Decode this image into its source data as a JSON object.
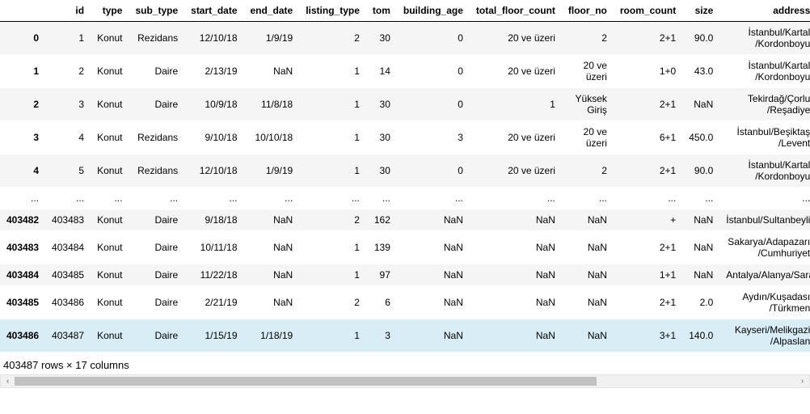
{
  "columns": [
    "",
    "id",
    "type",
    "sub_type",
    "start_date",
    "end_date",
    "listing_type",
    "tom",
    "building_age",
    "total_floor_count",
    "floor_no",
    "room_count",
    "size",
    "address"
  ],
  "rows": [
    {
      "idx": "0",
      "id": "1",
      "type": "Konut",
      "sub_type": "Rezidans",
      "start_date": "12/10/18",
      "end_date": "1/9/19",
      "listing_type": "2",
      "tom": "30",
      "building_age": "0",
      "total_floor_count": "20 ve üzeri",
      "floor_no": "2",
      "room_count": "2+1",
      "size": "90.0",
      "address": "İstanbul/Kartal /Kordonboyu",
      "band": true
    },
    {
      "idx": "1",
      "id": "2",
      "type": "Konut",
      "sub_type": "Daire",
      "start_date": "2/13/19",
      "end_date": "NaN",
      "listing_type": "1",
      "tom": "14",
      "building_age": "0",
      "total_floor_count": "20 ve üzeri",
      "floor_no": "20 ve üzeri",
      "room_count": "1+0",
      "size": "43.0",
      "address": "İstanbul/Kartal /Kordonboyu",
      "band": false
    },
    {
      "idx": "2",
      "id": "3",
      "type": "Konut",
      "sub_type": "Daire",
      "start_date": "10/9/18",
      "end_date": "11/8/18",
      "listing_type": "1",
      "tom": "30",
      "building_age": "0",
      "total_floor_count": "1",
      "floor_no": "Yüksek Giriş",
      "room_count": "2+1",
      "size": "NaN",
      "address": "Tekirdağ/Çorlu /Reşadiye",
      "band": true
    },
    {
      "idx": "3",
      "id": "4",
      "type": "Konut",
      "sub_type": "Rezidans",
      "start_date": "9/10/18",
      "end_date": "10/10/18",
      "listing_type": "1",
      "tom": "30",
      "building_age": "3",
      "total_floor_count": "20 ve üzeri",
      "floor_no": "20 ve üzeri",
      "room_count": "6+1",
      "size": "450.0",
      "address": "İstanbul/Beşiktaş /Levent",
      "band": false
    },
    {
      "idx": "4",
      "id": "5",
      "type": "Konut",
      "sub_type": "Rezidans",
      "start_date": "12/10/18",
      "end_date": "1/9/19",
      "listing_type": "1",
      "tom": "30",
      "building_age": "0",
      "total_floor_count": "20 ve üzeri",
      "floor_no": "2",
      "room_count": "2+1",
      "size": "90.0",
      "address": "İstanbul/Kartal /Kordonboyu",
      "band": true
    },
    {
      "idx": "...",
      "id": "...",
      "type": "...",
      "sub_type": "...",
      "start_date": "...",
      "end_date": "...",
      "listing_type": "...",
      "tom": "...",
      "building_age": "...",
      "total_floor_count": "...",
      "floor_no": "...",
      "room_count": "...",
      "size": "...",
      "address": "...",
      "ellipsis": true,
      "band": false
    },
    {
      "idx": "403482",
      "id": "403483",
      "type": "Konut",
      "sub_type": "Daire",
      "start_date": "9/18/18",
      "end_date": "NaN",
      "listing_type": "2",
      "tom": "162",
      "building_age": "NaN",
      "total_floor_count": "NaN",
      "floor_no": "NaN",
      "room_count": "+",
      "size": "NaN",
      "address": "İstanbul/Sultanbeyli/Adil",
      "band": true
    },
    {
      "idx": "403483",
      "id": "403484",
      "type": "Konut",
      "sub_type": "Daire",
      "start_date": "10/11/18",
      "end_date": "NaN",
      "listing_type": "1",
      "tom": "139",
      "building_age": "NaN",
      "total_floor_count": "NaN",
      "floor_no": "NaN",
      "room_count": "2+1",
      "size": "NaN",
      "address": "Sakarya/Adapazarı /Cumhuriyet",
      "band": false
    },
    {
      "idx": "403484",
      "id": "403485",
      "type": "Konut",
      "sub_type": "Daire",
      "start_date": "11/22/18",
      "end_date": "NaN",
      "listing_type": "1",
      "tom": "97",
      "building_age": "NaN",
      "total_floor_count": "NaN",
      "floor_no": "NaN",
      "room_count": "1+1",
      "size": "NaN",
      "address": "Antalya/Alanya/Saray",
      "band": true
    },
    {
      "idx": "403485",
      "id": "403486",
      "type": "Konut",
      "sub_type": "Daire",
      "start_date": "2/21/19",
      "end_date": "NaN",
      "listing_type": "2",
      "tom": "6",
      "building_age": "NaN",
      "total_floor_count": "NaN",
      "floor_no": "NaN",
      "room_count": "2+1",
      "size": "2.0",
      "address": "Aydın/Kuşadası /Türkmen",
      "band": false
    },
    {
      "idx": "403486",
      "id": "403487",
      "type": "Konut",
      "sub_type": "Daire",
      "start_date": "1/15/19",
      "end_date": "1/18/19",
      "listing_type": "1",
      "tom": "3",
      "building_age": "NaN",
      "total_floor_count": "NaN",
      "floor_no": "NaN",
      "room_count": "3+1",
      "size": "140.0",
      "address": "Kayseri/Melikgazi /Alpaslan",
      "highlight": true,
      "band": false
    }
  ],
  "footer": "403487 rows × 17 columns",
  "scroll": {
    "left_glyph": "‹",
    "right_glyph": "›"
  }
}
